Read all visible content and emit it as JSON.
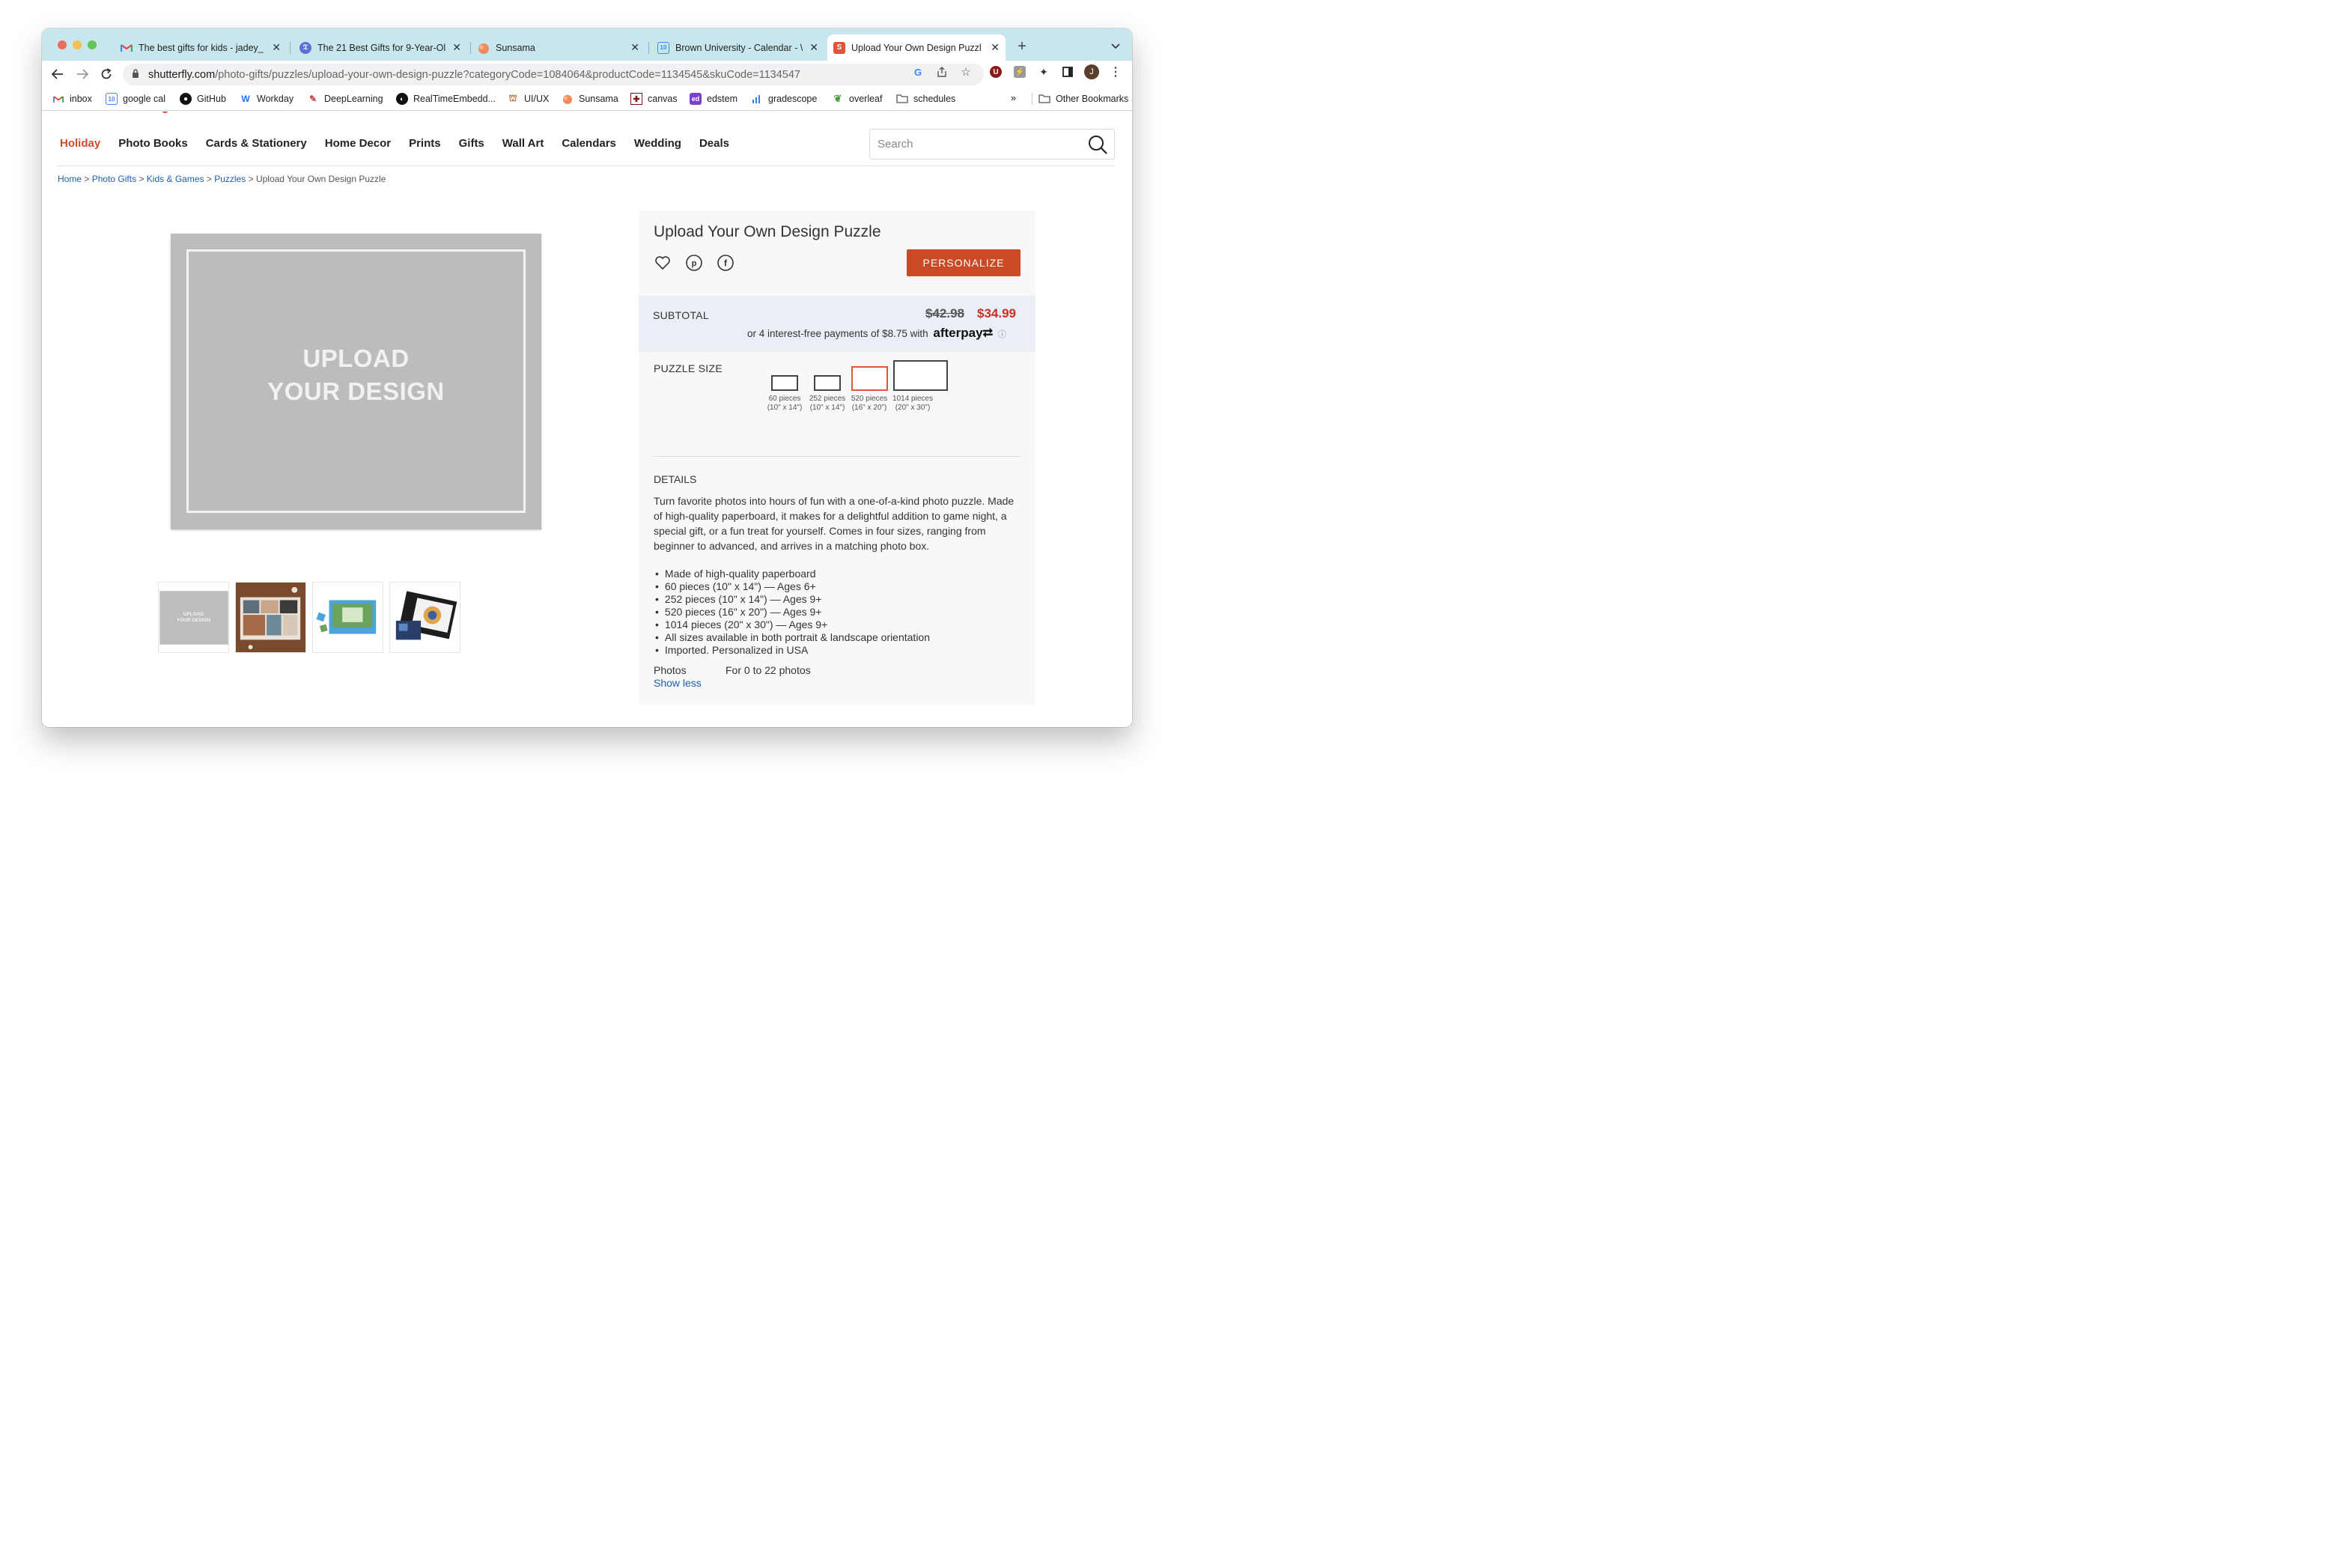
{
  "browser": {
    "tabs": [
      {
        "title": "The best gifts for kids - jadey_",
        "icon": "gmail-icon"
      },
      {
        "title": "The 21 Best Gifts for 9-Year-Ol",
        "icon": "nyt-icon"
      },
      {
        "title": "Sunsama",
        "icon": "sunsama-icon"
      },
      {
        "title": "Brown University - Calendar - \\",
        "icon": "calendar-icon"
      },
      {
        "title": "Upload Your Own Design Puzzl",
        "icon": "shutterfly-icon",
        "active": true
      }
    ],
    "url_domain": "shutterfly.com",
    "url_path": "/photo-gifts/puzzles/upload-your-own-design-puzzle?categoryCode=1084064&productCode=1134545&skuCode=1134547",
    "profile_initial": "J",
    "bookmarks": [
      "inbox",
      "google cal",
      "GitHub",
      "Workday",
      "DeepLearning",
      "RealTimeEmbedd...",
      "UI/UX",
      "Sunsama",
      "canvas",
      "edstem",
      "gradescope",
      "overleaf",
      "schedules"
    ],
    "bookmarks_overflow": "»",
    "other_bookmarks": "Other Bookmarks",
    "calendar_badge": "10"
  },
  "site": {
    "nav": [
      "Holiday",
      "Photo Books",
      "Cards & Stationery",
      "Home Decor",
      "Prints",
      "Gifts",
      "Wall Art",
      "Calendars",
      "Wedding",
      "Deals"
    ],
    "search_placeholder": "Search",
    "accent_color": "#d4482b",
    "breadcrumb": {
      "items": [
        "Home",
        "Photo Gifts",
        "Kids & Games",
        "Puzzles"
      ],
      "current": "Upload Your Own Design Puzzle",
      "separator": ">"
    }
  },
  "product": {
    "hero_text_line1": "UPLOAD",
    "hero_text_line2": "YOUR DESIGN",
    "thumb_text": "UPLOAD YOUR DESIGN",
    "title": "Upload Your Own Design Puzzle",
    "personalize_label": "PERSONALIZE",
    "subtotal_label": "SUBTOTAL",
    "old_price": "$42.98",
    "new_price": "$34.99",
    "payments_text": "or 4 interest-free payments of $8.75 with",
    "afterpay": "afterpay",
    "size_label": "PUZZLE SIZE",
    "sizes": [
      {
        "pieces": "60 pieces",
        "dims": "(10\" x 14\")",
        "selected": false
      },
      {
        "pieces": "252 pieces",
        "dims": "(10\" x 14\")",
        "selected": false
      },
      {
        "pieces": "520 pieces",
        "dims": "(16\" x 20\")",
        "selected": true
      },
      {
        "pieces": "1014 pieces",
        "dims": "(20\" x 30\")",
        "selected": false
      }
    ],
    "details_label": "DETAILS",
    "description": "Turn favorite photos into hours of fun with a one-of-a-kind photo puzzle. Made of high-quality paperboard, it makes for a delightful addition to game night, a special gift, or a fun treat for yourself. Comes in four sizes, ranging from beginner to advanced, and arrives in a matching photo box.",
    "bullets": [
      "Made of high-quality paperboard",
      "60 pieces (10\" x 14\") — Ages 6+",
      "252 pieces (10\" x 14\") — Ages 9+",
      "520 pieces (16\" x 20\") — Ages 9+",
      "1014 pieces (20\" x 30\") — Ages 9+",
      "All sizes available in both portrait & landscape orientation",
      "Imported. Personalized in USA"
    ],
    "photos_label": "Photos",
    "photos_value": "For 0 to 22 photos",
    "show_less": "Show less"
  }
}
